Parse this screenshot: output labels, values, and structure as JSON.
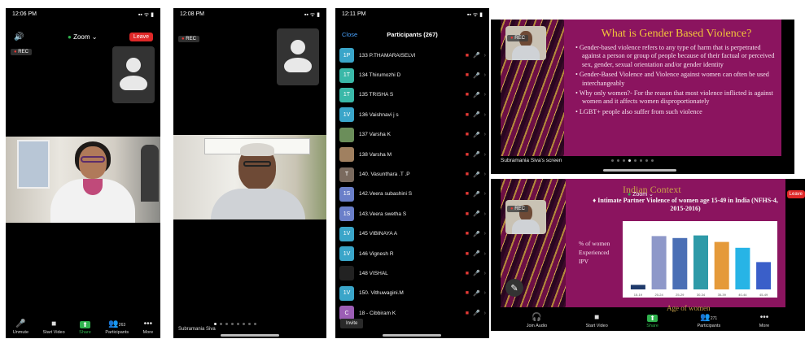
{
  "panel1": {
    "status_time": "12:06 PM",
    "status_icons": "▪▪ ᯤ ▮",
    "app_label": "Zoom",
    "leave": "Leave",
    "rec": "REC",
    "toolbar": [
      {
        "icon": "mic-off-icon",
        "glyph": "🎤",
        "label": "Unmute"
      },
      {
        "icon": "camera-off-icon",
        "glyph": "■",
        "label": "Start Video"
      },
      {
        "icon": "share-icon",
        "glyph": "⬆",
        "label": "Share"
      },
      {
        "icon": "participants-icon",
        "glyph": "👥",
        "label": "Participants",
        "count": "263"
      },
      {
        "icon": "more-icon",
        "glyph": "•••",
        "label": "More"
      }
    ]
  },
  "panel2": {
    "status_time": "12:08 PM",
    "rec": "REC",
    "speaker_name": "Subramania Siva"
  },
  "panel3": {
    "status_time": "12:11 PM",
    "close": "Close",
    "title": "Participants (267)",
    "invite": "Invite",
    "participants": [
      {
        "initials": "1P",
        "color": "#3aa5c9",
        "name": "133 P.THAMARAISELVI"
      },
      {
        "initials": "1T",
        "color": "#3ab8a8",
        "name": "134 Thirumozhi D"
      },
      {
        "initials": "1T",
        "color": "#3ab8a8",
        "name": "135 TRISHA S"
      },
      {
        "initials": "1V",
        "color": "#3aa5c9",
        "name": "136 Vaishnavi j s"
      },
      {
        "initials": "",
        "color": "#6b8e5a",
        "name": "137 Varsha K"
      },
      {
        "initials": "",
        "color": "#a08060",
        "name": "138 Varsha M"
      },
      {
        "initials": "T",
        "color": "#7a6a5e",
        "name": "140. Vasunthara .T .P"
      },
      {
        "initials": "1S",
        "color": "#6a7fc9",
        "name": "142.Veera subashini S"
      },
      {
        "initials": "1S",
        "color": "#6a7fc9",
        "name": "143.Veera swetha S"
      },
      {
        "initials": "1V",
        "color": "#3aa5c9",
        "name": "145 VIBINAYA A"
      },
      {
        "initials": "1V",
        "color": "#3aa5c9",
        "name": "146 Vignesh R"
      },
      {
        "initials": "",
        "color": "#222222",
        "name": "148 VISHAL"
      },
      {
        "initials": "1V",
        "color": "#3aa5c9",
        "name": "150. Vithuwagini.M"
      },
      {
        "initials": "C",
        "color": "#9c5eb5",
        "name": "18 - Cibbiram K"
      }
    ]
  },
  "panel4": {
    "rec": "REC",
    "title": "What is Gender Based Violence?",
    "bullets": [
      "Gender-based violence refers to any type of harm that is perpetrated against a person or group of people because of their factual or perceived sex, gender, sexual orientation and/or gender identity",
      "Gender-Based Violence and Violence against women can often be used interchangeably",
      "Why only women?- For the reason that most violence inflicted is against women and it affects women disproportionately",
      "LGBT+ people also suffer from such violence"
    ],
    "caption": "Subramania Siva's screen"
  },
  "panel5": {
    "rec": "REC",
    "app_label": "Zoom",
    "leave": "Leave",
    "title": "Indian Context",
    "subtitle": "Intimate Partner Violence of women age 15-49 in India (NFHS-4, 2015-2016)",
    "toolbar": [
      {
        "icon": "join-audio-icon",
        "glyph": "🎧",
        "label": "Join Audio"
      },
      {
        "icon": "camera-off-icon",
        "glyph": "■",
        "label": "Start Video"
      },
      {
        "icon": "share-icon",
        "glyph": "⬆",
        "label": "Share"
      },
      {
        "icon": "participants-icon",
        "glyph": "👥",
        "label": "Participants",
        "count": "271"
      },
      {
        "icon": "more-icon",
        "glyph": "•••",
        "label": "More"
      }
    ]
  },
  "chart_data": {
    "type": "bar",
    "ylabel": "% of women Experienced IPV",
    "xlabel": "Age of women",
    "categories": [
      "15-19",
      "20-24",
      "25-29",
      "30-34",
      "35-39",
      "40-44",
      "45-49"
    ],
    "values": [
      7,
      82,
      79,
      83,
      73,
      64,
      42
    ],
    "colors": [
      "#1f3a6b",
      "#8e98c9",
      "#4a6fb5",
      "#2e9aa8",
      "#e59a3a",
      "#27b4e6",
      "#3a5fc9"
    ],
    "ylim": [
      0,
      100
    ]
  }
}
